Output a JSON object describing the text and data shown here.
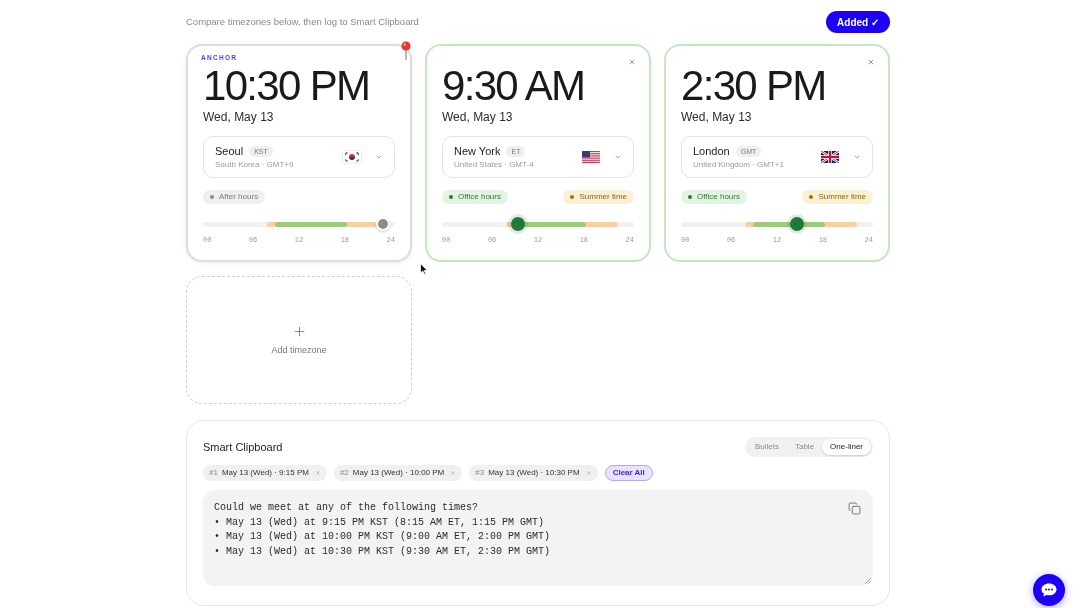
{
  "header": {
    "hint": "Compare timezones below, then log to Smart Clipboard",
    "added_button": "Added ✓"
  },
  "timezone_cards": [
    {
      "anchor": true,
      "anchor_label": "ANCHOR",
      "in_office_hours": false,
      "time": "10:30 PM",
      "date": "Wed, May 13",
      "city": "Seoul",
      "abbreviation": "KST",
      "region": "South Korea · GMT+9",
      "flag": {
        "kind": "kr"
      },
      "chips": [
        {
          "kind": "after_hours",
          "label": "After hours"
        }
      ],
      "timeline": {
        "level": 0.9375,
        "ticks": [
          "00",
          "06",
          "12",
          "18",
          "24"
        ]
      }
    },
    {
      "anchor": false,
      "in_office_hours": true,
      "time": "9:30 AM",
      "date": "Wed, May 13",
      "city": "New York",
      "abbreviation": "ET",
      "region": "United States · GMT-4",
      "flag": {
        "kind": "us"
      },
      "chips": [
        {
          "kind": "office_hours",
          "label": "Office hours"
        },
        {
          "kind": "summer_time",
          "label": "Summer time"
        }
      ],
      "timeline": {
        "level": 0.3958,
        "ticks": [
          "00",
          "06",
          "12",
          "18",
          "24"
        ]
      }
    },
    {
      "anchor": false,
      "in_office_hours": true,
      "time": "2:30 PM",
      "date": "Wed, May 13",
      "city": "London",
      "abbreviation": "GMT",
      "region": "United Kingdom · GMT+1",
      "flag": {
        "kind": "gb"
      },
      "chips": [
        {
          "kind": "office_hours",
          "label": "Office hours"
        },
        {
          "kind": "summer_time",
          "label": "Summer time"
        }
      ],
      "timeline": {
        "level": 0.6042,
        "ticks": [
          "00",
          "06",
          "12",
          "18",
          "24"
        ]
      }
    }
  ],
  "add_card": {
    "label": "Add timezone"
  },
  "clipboard": {
    "title": "Smart Clipboard",
    "formats": [
      {
        "label": "Bullets",
        "selected": false
      },
      {
        "label": "Table",
        "selected": false
      },
      {
        "label": "One-liner",
        "selected": true
      }
    ],
    "slots": [
      {
        "number": "#1",
        "label": "May 13 (Wed) · 9:15 PM"
      },
      {
        "number": "#2",
        "label": "May 13 (Wed) · 10:00 PM"
      },
      {
        "number": "#3",
        "label": "May 13 (Wed) · 10:30 PM"
      }
    ],
    "clear_button": "Clear All",
    "output_lines": [
      "Could we meet at any of the following times?",
      "• May 13 (Wed) at 9:15 PM KST (8:15 AM ET, 1:15 PM GMT)",
      "• May 13 (Wed) at 10:00 PM KST (9:00 AM ET, 2:00 PM GMT)",
      "• May 13 (Wed) at 10:30 PM KST (9:30 AM ET, 2:30 PM GMT)"
    ]
  }
}
